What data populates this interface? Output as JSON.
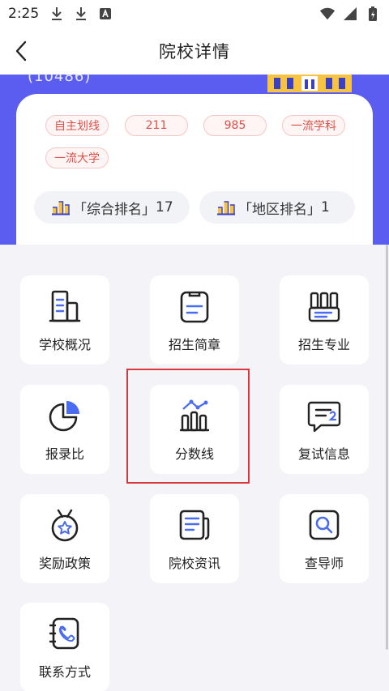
{
  "status_bar": {
    "time": "2:25"
  },
  "header": {
    "title": "院校详情"
  },
  "hero": {
    "code_text": "(10486)"
  },
  "tags": [
    "自主划线",
    "211",
    "985",
    "一流学科",
    "一流大学"
  ],
  "ranks": [
    {
      "label": "「综合排名」",
      "value": "17"
    },
    {
      "label": "「地区排名」",
      "value": "1"
    }
  ],
  "tiles": [
    {
      "label": "学校概况",
      "icon": "building-icon"
    },
    {
      "label": "招生简章",
      "icon": "clipboard-icon"
    },
    {
      "label": "招生专业",
      "icon": "books-icon"
    },
    {
      "label": "报录比",
      "icon": "pie-chart-icon"
    },
    {
      "label": "分数线",
      "icon": "bar-chart-icon"
    },
    {
      "label": "复试信息",
      "icon": "message-icon"
    },
    {
      "label": "奖励政策",
      "icon": "medal-icon"
    },
    {
      "label": "院校资讯",
      "icon": "news-icon"
    },
    {
      "label": "查导师",
      "icon": "search-doc-icon"
    },
    {
      "label": "联系方式",
      "icon": "phone-book-icon"
    }
  ],
  "colors": {
    "accent": "#5b5cf0",
    "tag_text": "#e0504a",
    "highlight": "#d9363e"
  }
}
